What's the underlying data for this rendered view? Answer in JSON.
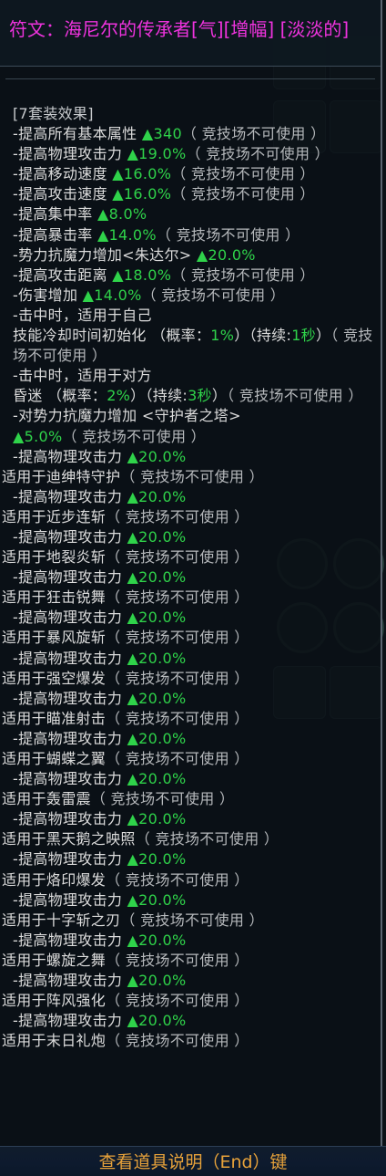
{
  "title": "符文：海尼尔的传承者[气][增幅] [淡淡的]",
  "set_header": "[7套装效果]",
  "lines": [
    {
      "t": "wrap",
      "parts": [
        [
          "w",
          "-提高所有基本属性 "
        ],
        [
          "g",
          "▲340"
        ],
        [
          "d",
          "（ 竞技场不可使用 ）"
        ]
      ]
    },
    {
      "t": "wrap",
      "parts": [
        [
          "w",
          "-提高物理攻击力 "
        ],
        [
          "g",
          "▲19.0%"
        ],
        [
          "d",
          "（ 竞技场不可使用 ）"
        ]
      ]
    },
    {
      "t": "row",
      "parts": [
        [
          "w",
          "-提高移动速度 "
        ],
        [
          "g",
          "▲16.0%"
        ],
        [
          "d",
          "（ 竞技场不可使用 ）"
        ]
      ]
    },
    {
      "t": "row",
      "parts": [
        [
          "w",
          "-提高攻击速度 "
        ],
        [
          "g",
          "▲16.0%"
        ],
        [
          "d",
          "（ 竞技场不可使用 ）"
        ]
      ]
    },
    {
      "t": "row",
      "parts": [
        [
          "w",
          "-提高集中率 "
        ],
        [
          "g",
          "▲8.0%"
        ]
      ]
    },
    {
      "t": "row",
      "parts": [
        [
          "w",
          "-提高暴击率 "
        ],
        [
          "g",
          "▲14.0%"
        ],
        [
          "d",
          "（ 竞技场不可使用 ）"
        ]
      ]
    },
    {
      "t": "row",
      "parts": [
        [
          "w",
          "-势力抗魔力增加<朱达尔>  "
        ],
        [
          "g",
          "▲20.0%"
        ]
      ]
    },
    {
      "t": "row",
      "parts": [
        [
          "w",
          "-提高攻击距离 "
        ],
        [
          "g",
          "▲18.0%"
        ],
        [
          "d",
          "（ 竞技场不可使用 ）"
        ]
      ]
    },
    {
      "t": "row",
      "parts": [
        [
          "w",
          "-伤害增加 "
        ],
        [
          "g",
          "▲14.0%"
        ],
        [
          "d",
          "（ 竞技场不可使用 ）"
        ]
      ]
    },
    {
      "t": "row",
      "parts": [
        [
          "w",
          "-击中时，适用于自己"
        ]
      ]
    },
    {
      "t": "wrap",
      "parts": [
        [
          "w",
          " 技能冷却时间初始化 （概率："
        ],
        [
          "g",
          "1%"
        ],
        [
          "w",
          "）（持续:"
        ],
        [
          "g",
          "1秒"
        ],
        [
          "w",
          "）"
        ],
        [
          "d",
          "（ 竞技场不可使用 ）"
        ]
      ]
    },
    {
      "t": "row",
      "parts": [
        [
          "w",
          "-击中时，适用于对方"
        ]
      ]
    },
    {
      "t": "wrap",
      "parts": [
        [
          "w",
          " 昏迷 （概率："
        ],
        [
          "g",
          "2%"
        ],
        [
          "w",
          "）（持续:"
        ],
        [
          "g",
          "3秒"
        ],
        [
          "w",
          "）"
        ],
        [
          "d",
          "（ 竞技场不可使用 ）"
        ]
      ]
    },
    {
      "t": "row",
      "parts": [
        [
          "w",
          "-对势力抗魔力增加 <守护者之塔>"
        ]
      ]
    },
    {
      "t": "row",
      "parts": [
        [
          "g",
          " ▲5.0%"
        ],
        [
          "d",
          "（ 竞技场不可使用 ）"
        ]
      ]
    },
    {
      "t": "row",
      "parts": [
        [
          "w",
          " -提高物理攻击力 "
        ],
        [
          "g",
          "▲20.0%"
        ]
      ]
    },
    {
      "t": "tight",
      "parts": [
        [
          "w",
          "适用于迪绅特守护"
        ],
        [
          "d",
          "（ 竞技场不可使用 ）"
        ]
      ]
    },
    {
      "t": "row",
      "parts": [
        [
          "w",
          " -提高物理攻击力 "
        ],
        [
          "g",
          "▲20.0%"
        ]
      ]
    },
    {
      "t": "tight",
      "parts": [
        [
          "w",
          "适用于近步连斩"
        ],
        [
          "d",
          "（ 竞技场不可使用 ）"
        ]
      ]
    },
    {
      "t": "row",
      "parts": [
        [
          "w",
          " -提高物理攻击力 "
        ],
        [
          "g",
          "▲20.0%"
        ]
      ]
    },
    {
      "t": "tight",
      "parts": [
        [
          "w",
          "适用于地裂炎斩"
        ],
        [
          "d",
          "（ 竞技场不可使用 ）"
        ]
      ]
    },
    {
      "t": "row",
      "parts": [
        [
          "w",
          " -提高物理攻击力 "
        ],
        [
          "g",
          "▲20.0%"
        ]
      ]
    },
    {
      "t": "tight",
      "parts": [
        [
          "w",
          "适用于狂击锐舞"
        ],
        [
          "d",
          "（ 竞技场不可使用 ）"
        ]
      ]
    },
    {
      "t": "row",
      "parts": [
        [
          "w",
          " -提高物理攻击力 "
        ],
        [
          "g",
          "▲20.0%"
        ]
      ]
    },
    {
      "t": "tight",
      "parts": [
        [
          "w",
          "适用于暴风旋斩"
        ],
        [
          "d",
          "（ 竞技场不可使用 ）"
        ]
      ]
    },
    {
      "t": "row",
      "parts": [
        [
          "w",
          " -提高物理攻击力 "
        ],
        [
          "g",
          "▲20.0%"
        ]
      ]
    },
    {
      "t": "tight",
      "parts": [
        [
          "w",
          "适用于强空爆发"
        ],
        [
          "d",
          "（ 竞技场不可使用 ）"
        ]
      ]
    },
    {
      "t": "row",
      "parts": [
        [
          "w",
          " -提高物理攻击力 "
        ],
        [
          "g",
          "▲20.0%"
        ]
      ]
    },
    {
      "t": "tight",
      "parts": [
        [
          "w",
          "适用于瞄准射击"
        ],
        [
          "d",
          "（ 竞技场不可使用 ）"
        ]
      ]
    },
    {
      "t": "row",
      "parts": [
        [
          "w",
          " -提高物理攻击力 "
        ],
        [
          "g",
          "▲20.0%"
        ]
      ]
    },
    {
      "t": "tight",
      "parts": [
        [
          "w",
          "适用于蝴蝶之翼"
        ],
        [
          "d",
          "（ 竞技场不可使用 ）"
        ]
      ]
    },
    {
      "t": "row",
      "parts": [
        [
          "w",
          " -提高物理攻击力 "
        ],
        [
          "g",
          "▲20.0%"
        ]
      ]
    },
    {
      "t": "tight",
      "parts": [
        [
          "w",
          "适用于轰雷震"
        ],
        [
          "d",
          "（ 竞技场不可使用 ）"
        ]
      ]
    },
    {
      "t": "row",
      "parts": [
        [
          "w",
          " -提高物理攻击力 "
        ],
        [
          "g",
          "▲20.0%"
        ]
      ]
    },
    {
      "t": "tight",
      "parts": [
        [
          "w",
          "适用于黑天鹅之映照"
        ],
        [
          "d",
          "（ 竞技场不可使用 ）"
        ]
      ]
    },
    {
      "t": "row",
      "parts": [
        [
          "w",
          " -提高物理攻击力 "
        ],
        [
          "g",
          "▲20.0%"
        ]
      ]
    },
    {
      "t": "tight",
      "parts": [
        [
          "w",
          "适用于烙印爆发"
        ],
        [
          "d",
          "（ 竞技场不可使用 ）"
        ]
      ]
    },
    {
      "t": "row",
      "parts": [
        [
          "w",
          " -提高物理攻击力 "
        ],
        [
          "g",
          "▲20.0%"
        ]
      ]
    },
    {
      "t": "tight",
      "parts": [
        [
          "w",
          "适用于十字斩之刃"
        ],
        [
          "d",
          "（ 竞技场不可使用 ）"
        ]
      ]
    },
    {
      "t": "row",
      "parts": [
        [
          "w",
          " -提高物理攻击力 "
        ],
        [
          "g",
          "▲20.0%"
        ]
      ]
    },
    {
      "t": "tight",
      "parts": [
        [
          "w",
          "适用于螺旋之舞"
        ],
        [
          "d",
          "（ 竞技场不可使用 ）"
        ]
      ]
    },
    {
      "t": "row",
      "parts": [
        [
          "w",
          " -提高物理攻击力 "
        ],
        [
          "g",
          "▲20.0%"
        ]
      ]
    },
    {
      "t": "tight",
      "parts": [
        [
          "w",
          "适用于阵风强化"
        ],
        [
          "d",
          "（ 竞技场不可使用 ）"
        ]
      ]
    },
    {
      "t": "row",
      "parts": [
        [
          "w",
          " -提高物理攻击力 "
        ],
        [
          "g",
          "▲20.0%"
        ]
      ]
    },
    {
      "t": "tight",
      "parts": [
        [
          "w",
          "适用于末日礼炮"
        ],
        [
          "d",
          "（ 竞技场不可使用 ）"
        ]
      ]
    }
  ],
  "footer": "查看道具说明（End）键",
  "colors": {
    "title": "#ee33dd",
    "value": "#2fd34a",
    "text": "#dcdcdc",
    "footer": "#e7a23a"
  }
}
